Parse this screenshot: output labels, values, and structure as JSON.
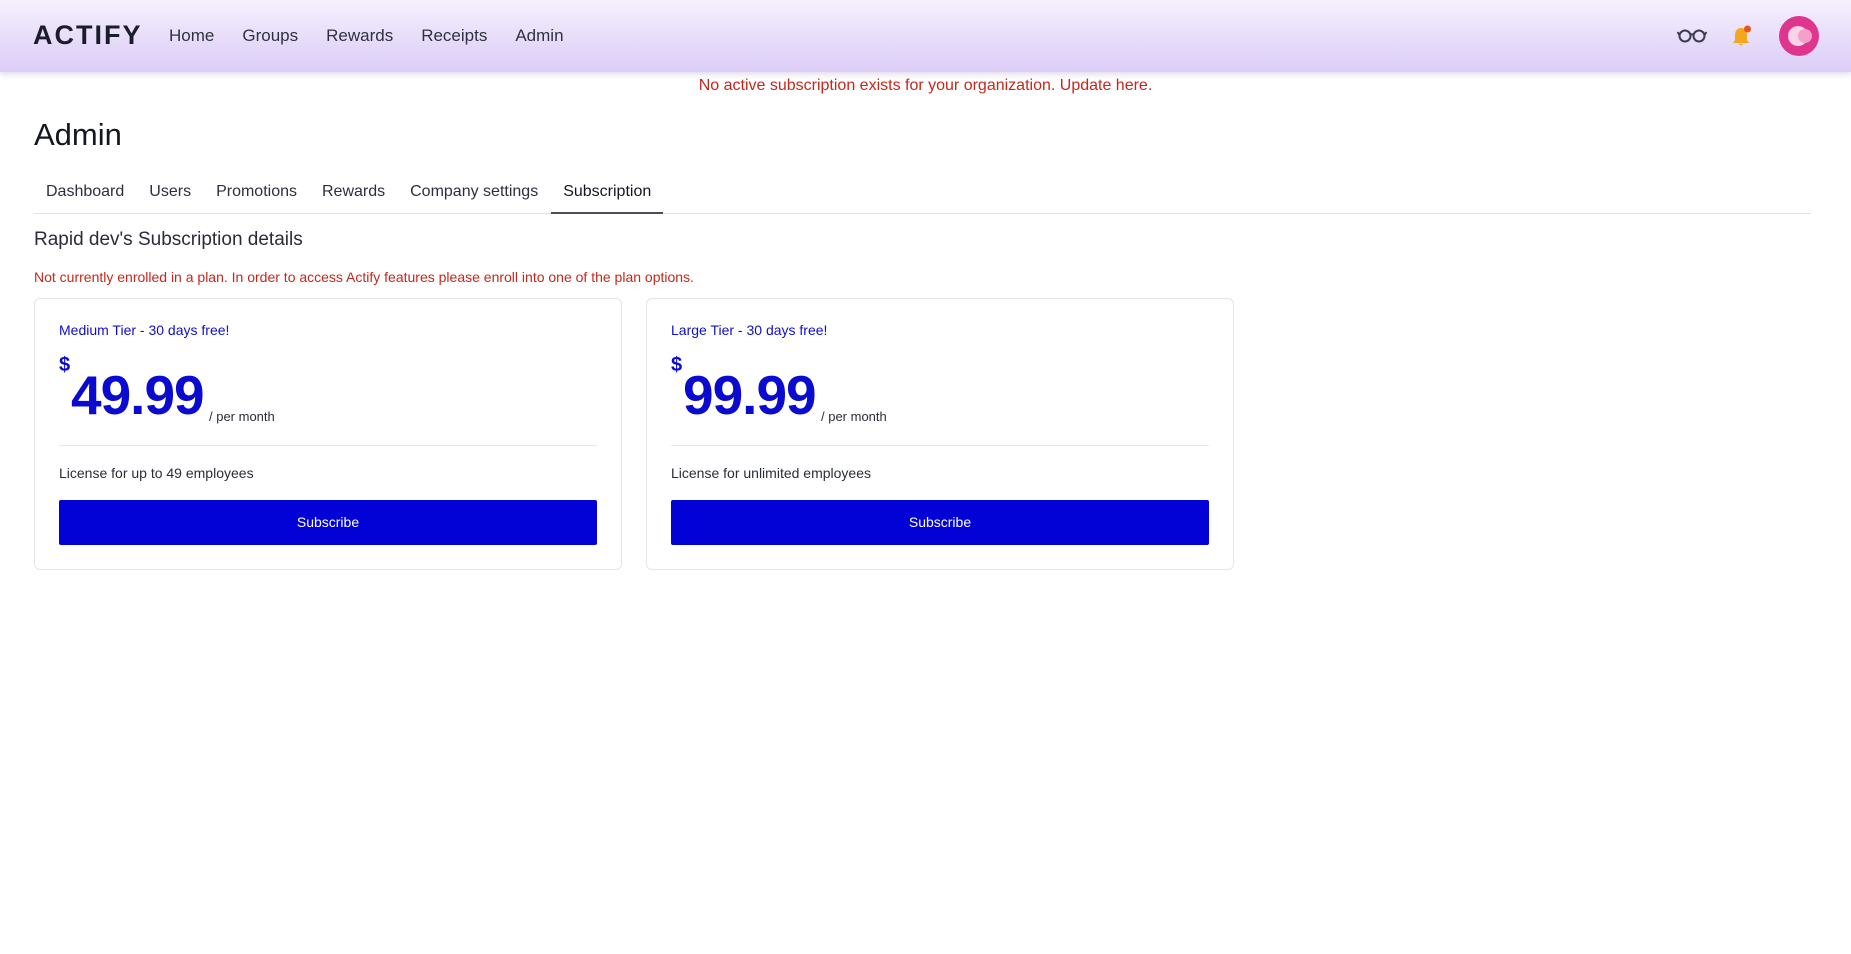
{
  "app": {
    "logo_text": "ACTIFY",
    "nav": [
      {
        "label": "Home"
      },
      {
        "label": "Groups"
      },
      {
        "label": "Rewards"
      },
      {
        "label": "Receipts"
      },
      {
        "label": "Admin"
      }
    ],
    "icons": [
      "glasses-icon",
      "bell-icon",
      "avatar"
    ],
    "colors": {
      "accent": "#0202d6",
      "error": "#c4281c",
      "notification_dot": "#e8551e",
      "bell": "#f2a81d",
      "avatar": "#e0358f"
    }
  },
  "alert": {
    "text": "No active subscription exists for your organization.",
    "link": "Update here."
  },
  "page": {
    "title": "Admin",
    "tabs": [
      {
        "label": "Dashboard",
        "active": false
      },
      {
        "label": "Users",
        "active": false
      },
      {
        "label": "Promotions",
        "active": false
      },
      {
        "label": "Rewards",
        "active": false
      },
      {
        "label": "Company settings",
        "active": false
      },
      {
        "label": "Subscription",
        "active": true
      }
    ],
    "section_title": "Rapid dev's Subscription details",
    "plan_warning": "Not currently enrolled in a plan. In order to access Actify features please enroll into one of the plan options."
  },
  "plans": [
    {
      "name": "Medium Tier - 30 days free!",
      "currency": "$",
      "price": "49.99",
      "period": "/ per month",
      "license": "License for up to 49 employees",
      "button": "Subscribe"
    },
    {
      "name": "Large Tier - 30 days free!",
      "currency": "$",
      "price": "99.99",
      "period": "/ per month",
      "license": "License for unlimited employees",
      "button": "Subscribe"
    }
  ]
}
